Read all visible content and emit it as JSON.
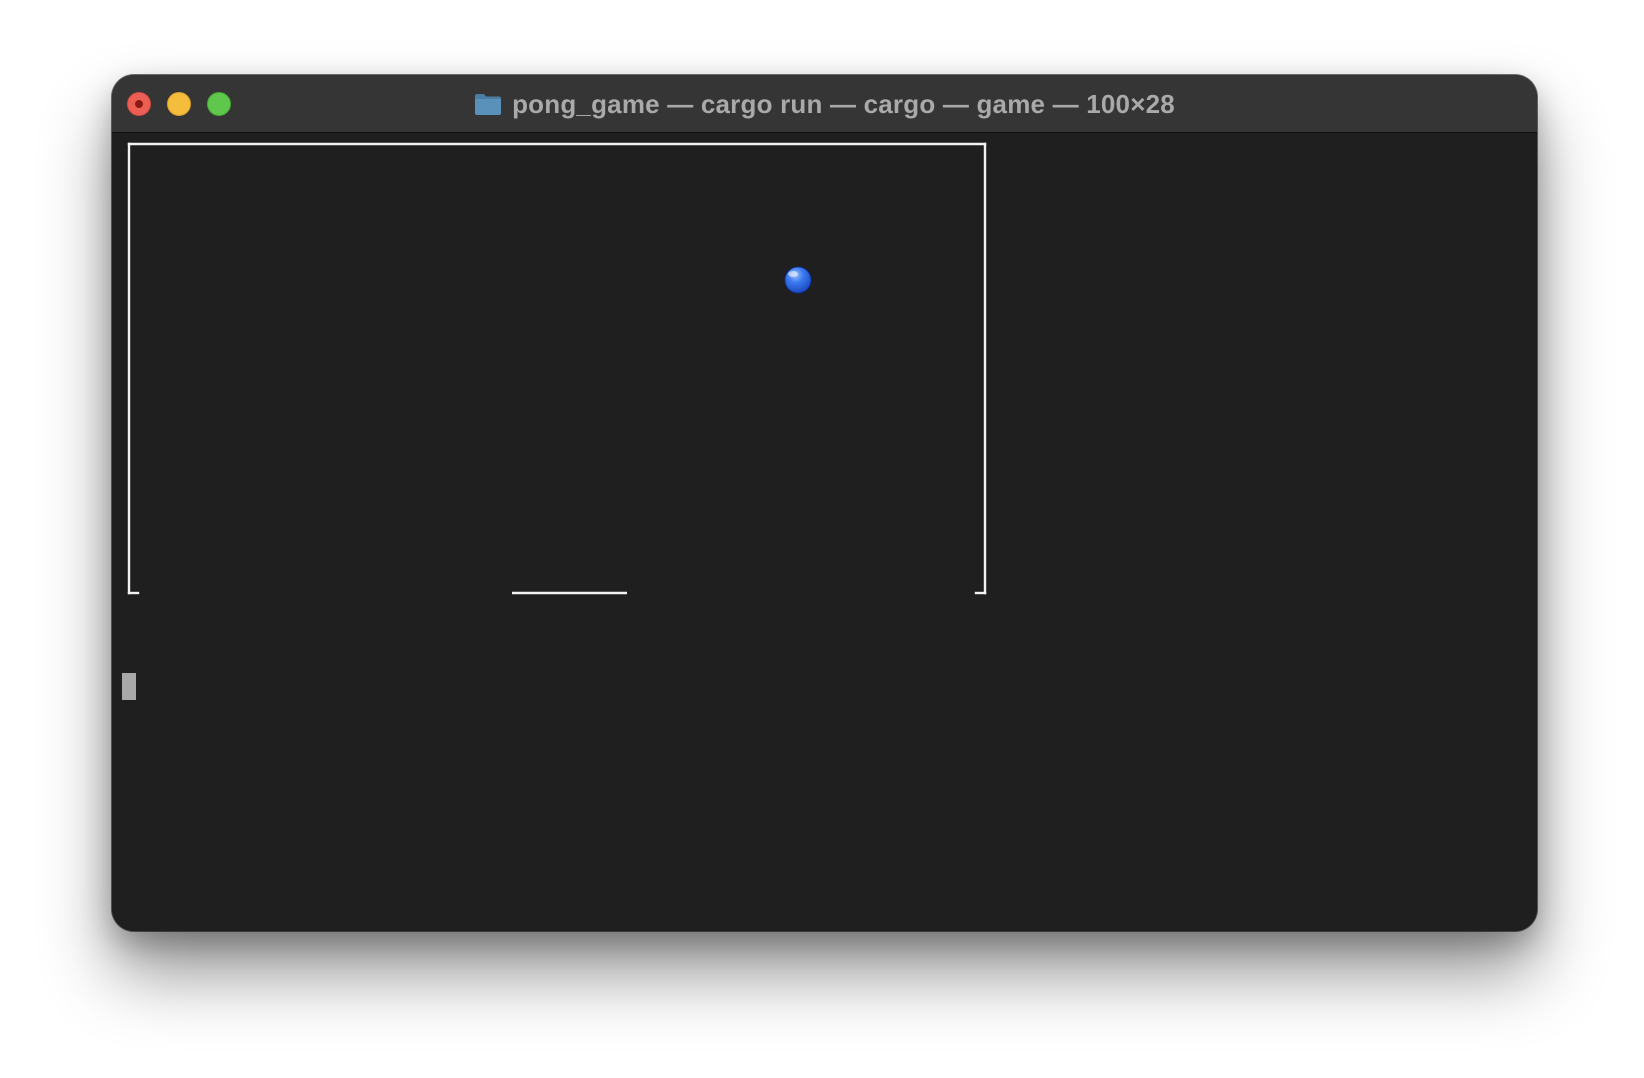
{
  "window": {
    "title": "pong_game — cargo run — cargo — game — 100×28",
    "title_icon": "folder-icon",
    "colors": {
      "close": "#ec5f55",
      "minimize": "#f4bd3b",
      "zoom": "#5fc74b",
      "terminal_bg": "#1f1f1f",
      "titlebar_bg": "#353535"
    }
  },
  "game": {
    "ball_color": "#1e4fd6",
    "line_color": "#f2f2f2"
  },
  "terminal": {
    "cursor": "block"
  }
}
